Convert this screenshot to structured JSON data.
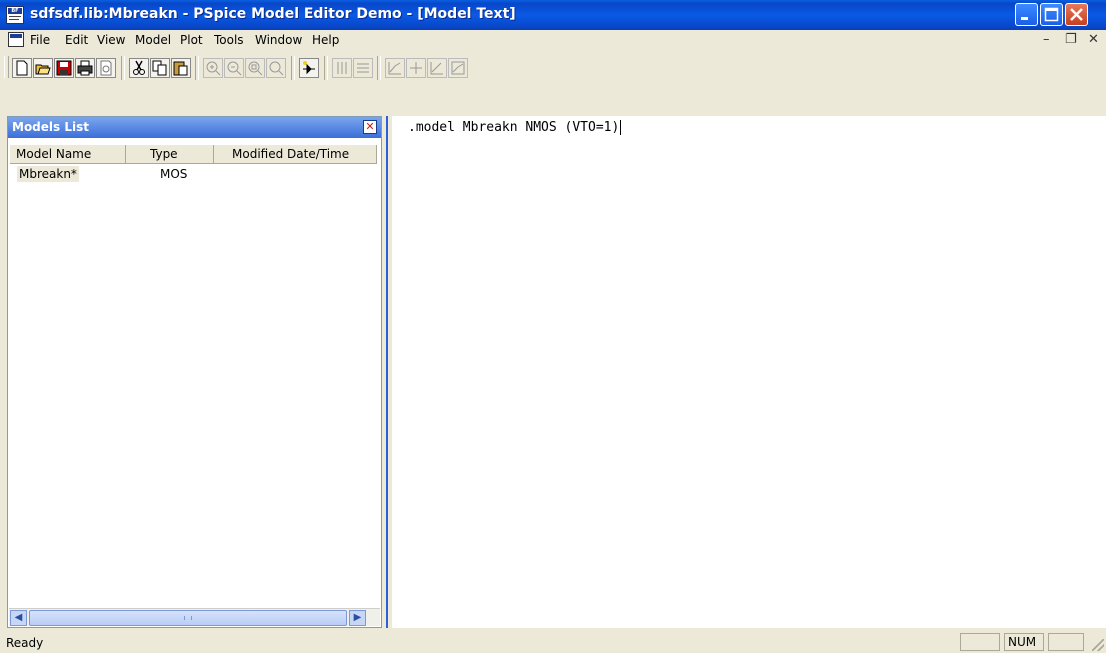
{
  "window": {
    "title": "sdfsdf.lib:Mbreakn - PSpice Model Editor Demo  - [Model Text]"
  },
  "menu": {
    "items": [
      "File",
      "Edit",
      "View",
      "Model",
      "Plot",
      "Tools",
      "Window",
      "Help"
    ]
  },
  "toolbar": {
    "icons": [
      "new-icon",
      "open-icon",
      "save-icon",
      "print-icon",
      "print-preview-icon",
      "cut-icon",
      "copy-icon",
      "paste-icon",
      "zoom-in-icon",
      "zoom-out-icon",
      "zoom-fit-icon",
      "zoom-area-icon",
      "extract-model-icon",
      "tile-vertical-icon",
      "tile-horizontal-icon",
      "plot-icon",
      "crosshair-icon",
      "add-point-icon",
      "plot-params-icon"
    ]
  },
  "models_panel": {
    "title": "Models List",
    "columns": [
      "Model Name",
      "Type",
      "Modified Date/Time"
    ],
    "rows": [
      {
        "name": "Mbreakn*",
        "type": "MOS",
        "modified": ""
      }
    ]
  },
  "editor": {
    "text": ".model Mbreakn NMOS (VTO=1)"
  },
  "status": {
    "text": "Ready",
    "num": "NUM"
  }
}
